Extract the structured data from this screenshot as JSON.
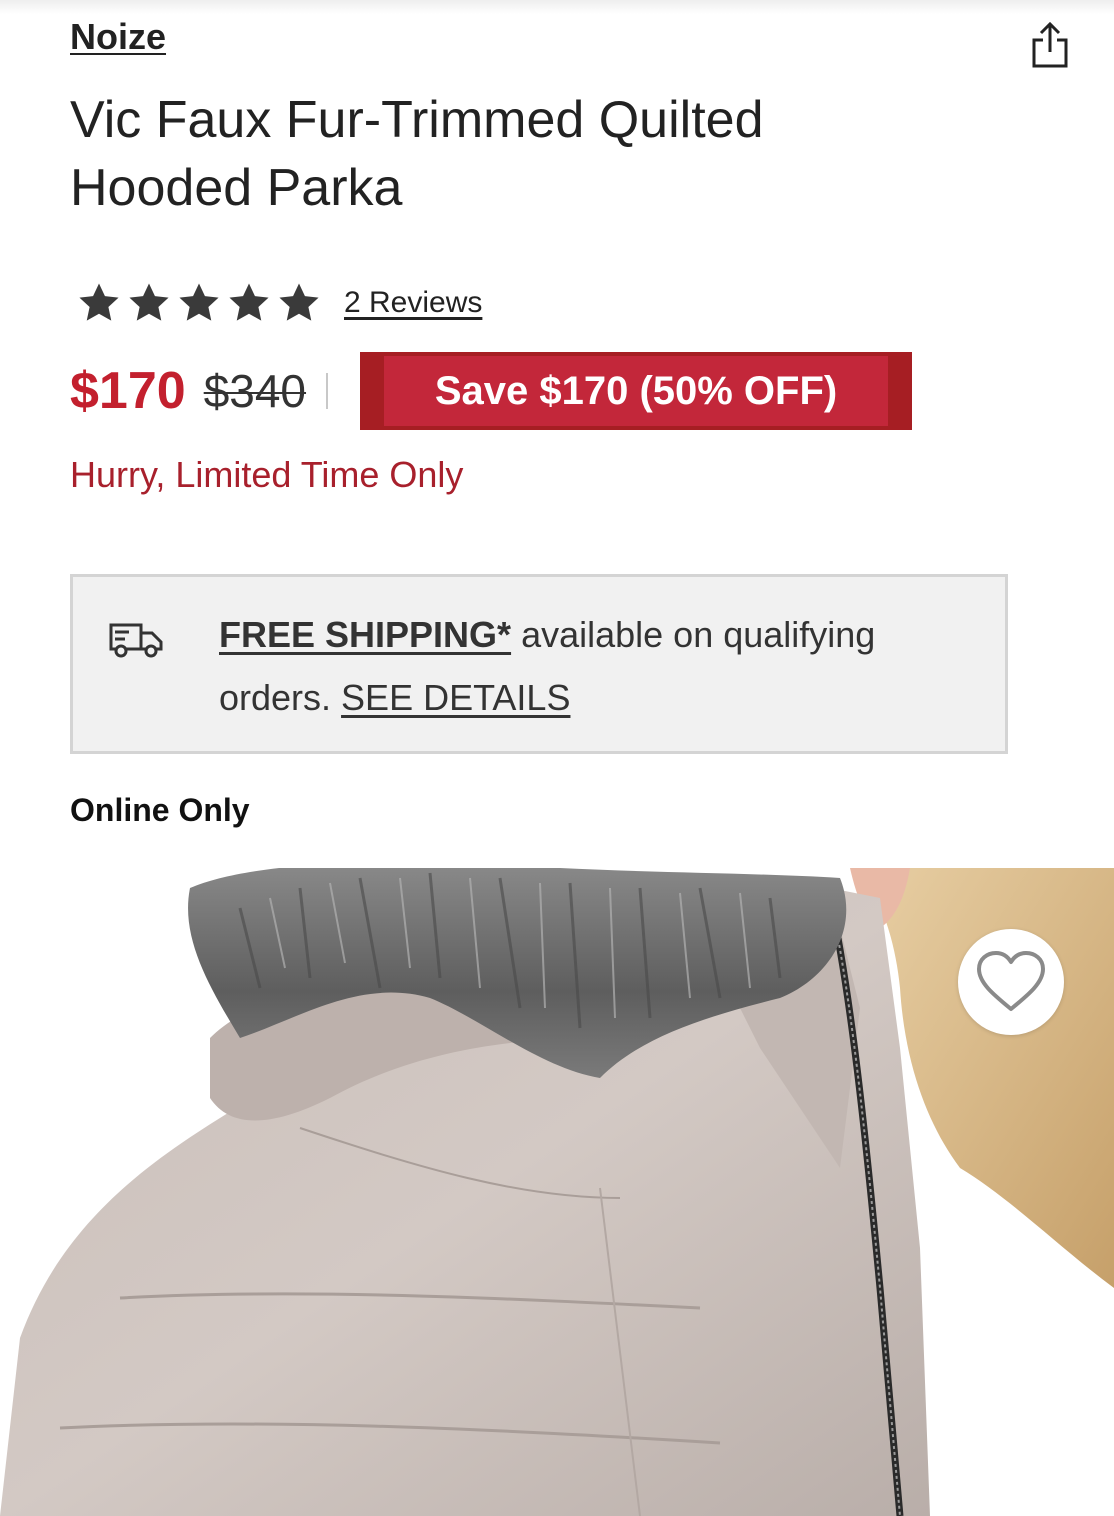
{
  "product": {
    "brand": "Noize",
    "title": "Vic Faux Fur-Trimmed Quilted Hooded Parka",
    "rating": 5,
    "reviews_label": "2 Reviews"
  },
  "pricing": {
    "sale_price": "$170",
    "original_price": "$340",
    "save_label": "Save $170 (50% OFF)",
    "urgency": "Hurry, Limited Time Only"
  },
  "shipping": {
    "free_label": "FREE SHIPPING*",
    "text_middle": " available on qualifying orders. ",
    "details_link": "SEE DETAILS"
  },
  "availability": "Online Only",
  "icons": {
    "share": "share-icon",
    "star": "star-icon",
    "truck": "truck-icon",
    "favorite": "heart-icon"
  },
  "colors": {
    "sale_red": "#c3202e",
    "badge_red": "#c3273a",
    "badge_border": "#a61e23"
  }
}
